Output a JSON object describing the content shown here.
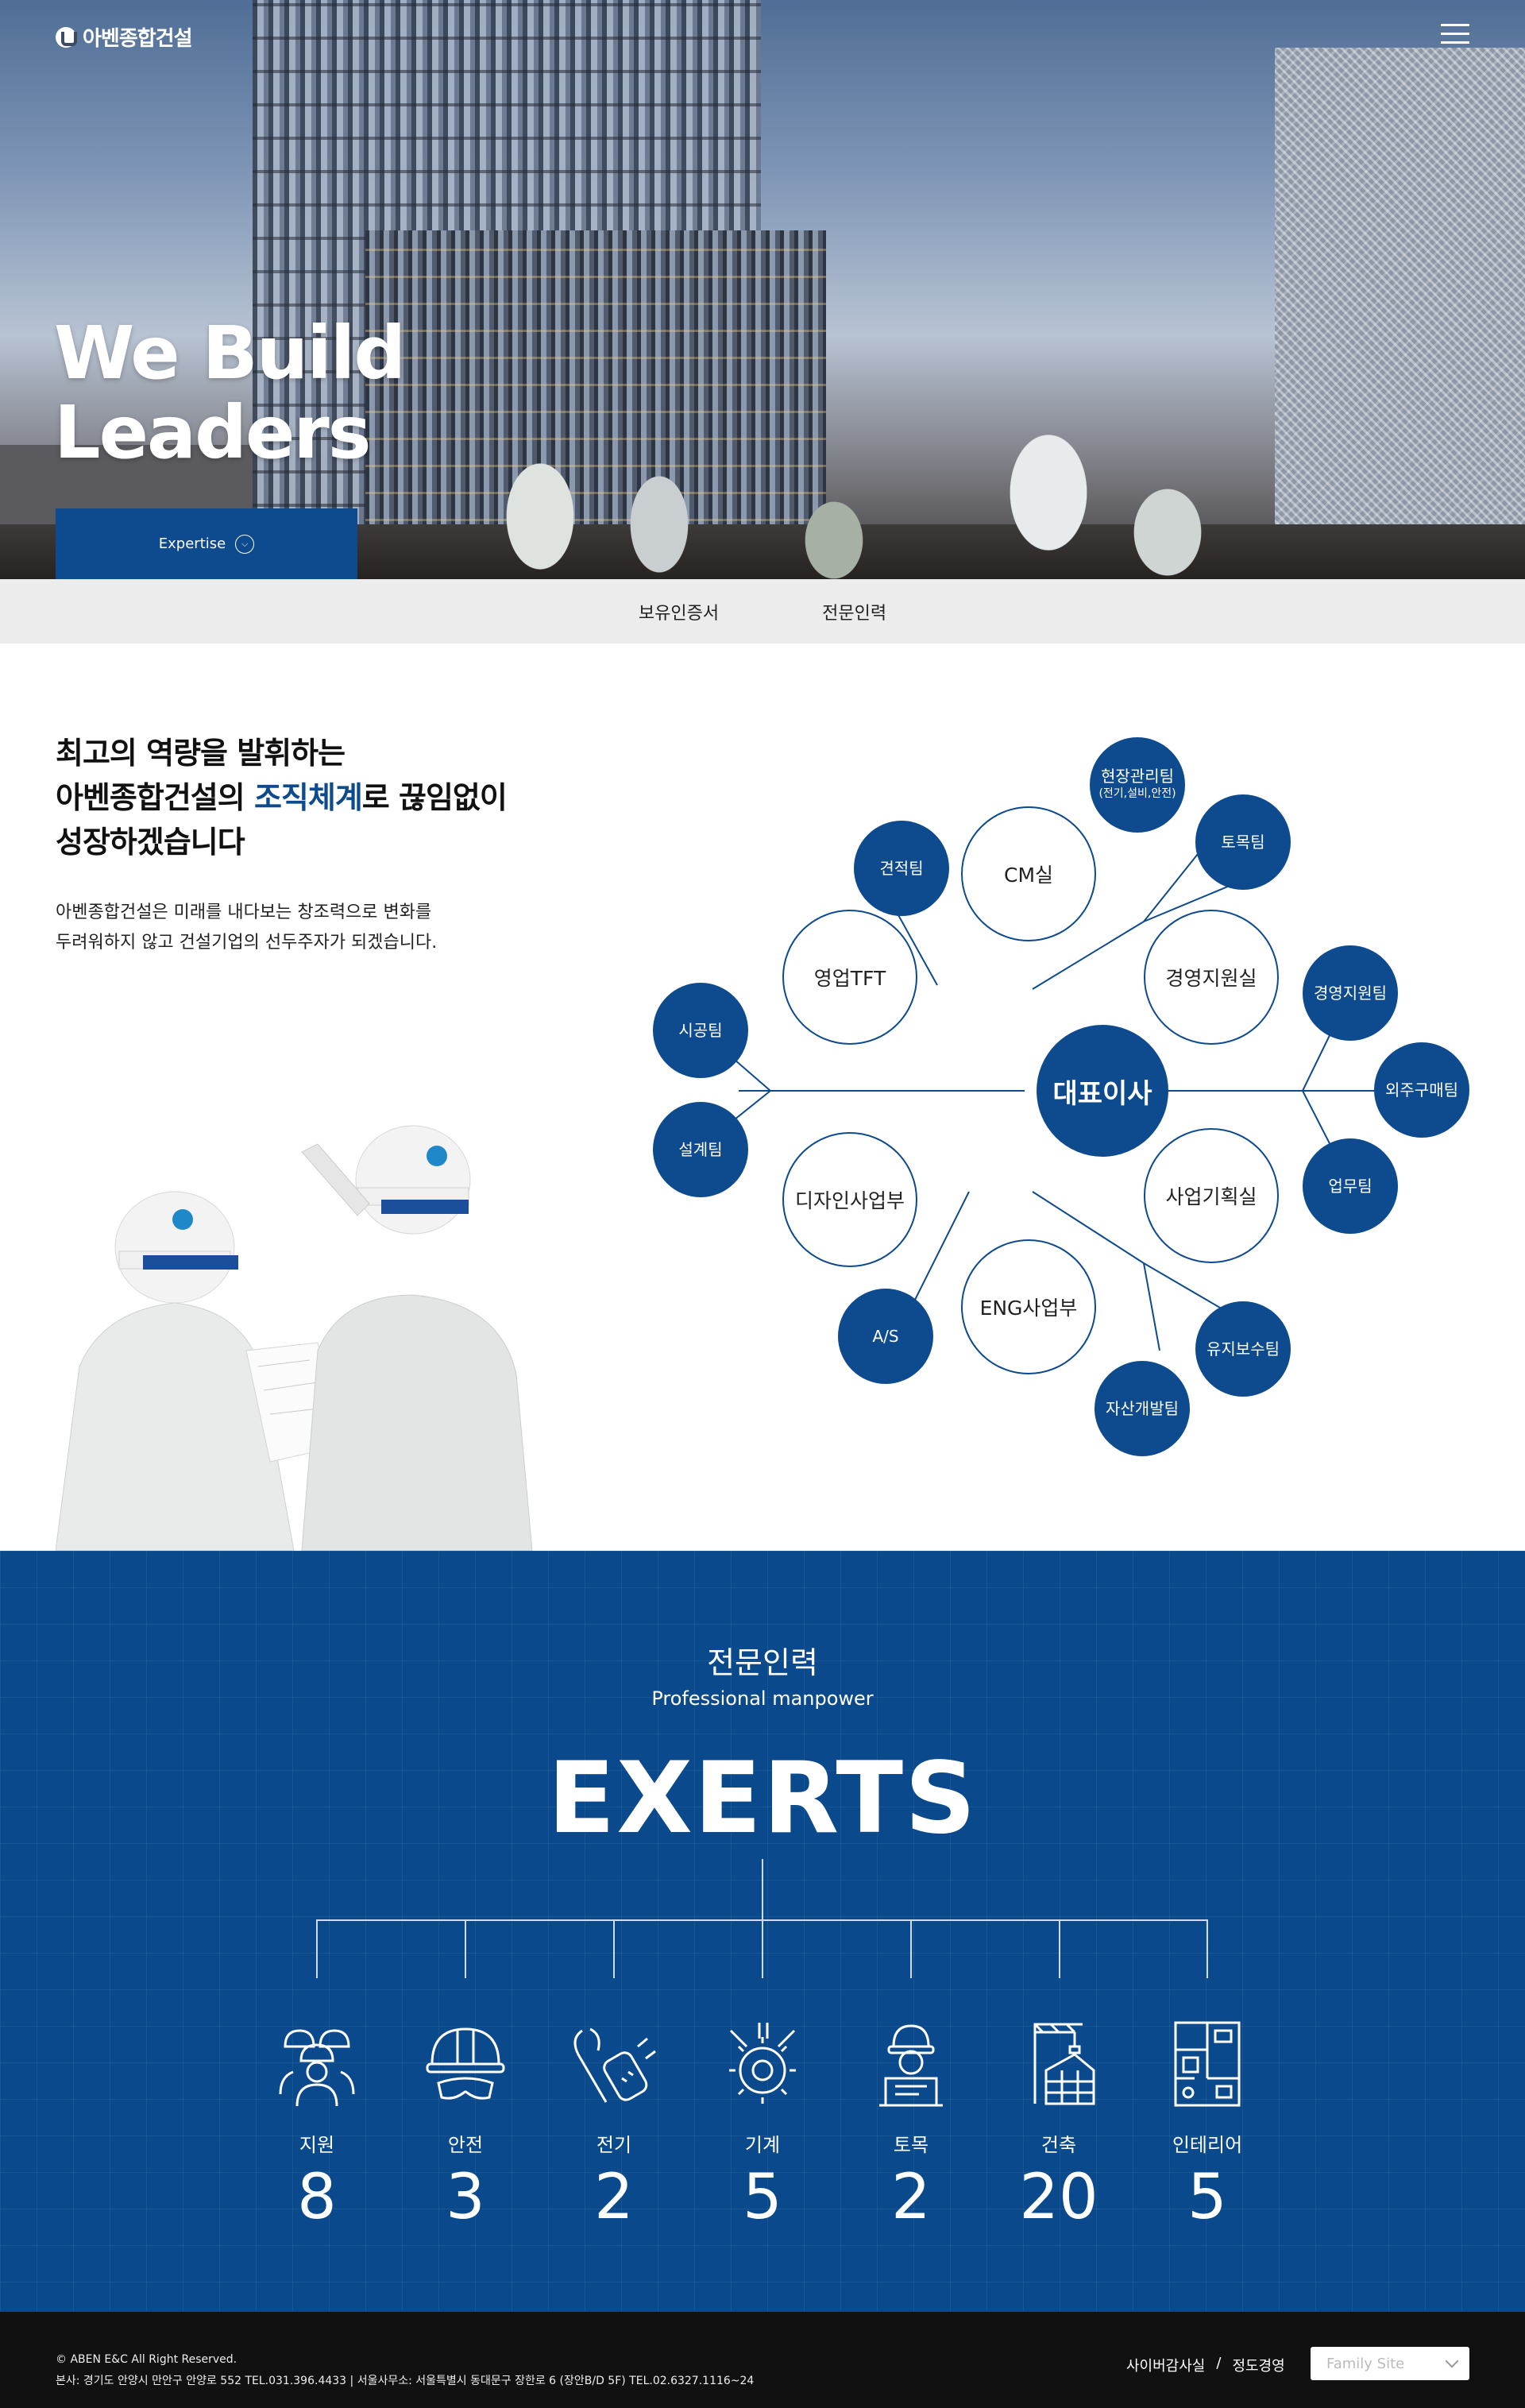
{
  "header": {
    "logo_text": "아벤종합건설",
    "menu_icon": "hamburger-menu-icon"
  },
  "hero": {
    "title_line1": "We Build",
    "title_line2": "Leaders",
    "button_label": "Expertise"
  },
  "tabs": [
    "보유인증서",
    "전문인력"
  ],
  "org": {
    "heading_line1": "최고의 역량을 발휘하는",
    "heading_line2_pre": "아벤종합건설의 ",
    "heading_line2_hl": "조직체계",
    "heading_line2_post": "로 끊임없이",
    "heading_line3": "성장하겠습니다",
    "desc_line1": "아벤종합건설은 미래를 내다보는 창조력으로 변화를",
    "desc_line2": "두려워하지 않고 건설기업의 선두주자가 되겠습니다.",
    "ceo": "대표이사",
    "departments": [
      "CM실",
      "경영지원실",
      "사업기획실",
      "ENG사업부",
      "디자인사업부",
      "영업TFT"
    ],
    "teams": {
      "t1": "현장관리팀",
      "t1_sub": "(전기,설비,안전)",
      "t2": "토목팀",
      "t3": "견적팀",
      "t4": "경영지원팀",
      "t5": "외주구매팀",
      "t6": "업무팀",
      "t7": "유지보수팀",
      "t8": "자산개발팀",
      "t9": "A/S",
      "t10": "시공팀",
      "t11": "설계팀"
    }
  },
  "experts": {
    "title": "전문인력",
    "subtitle": "Professional manpower",
    "big": "EXERTS",
    "items": [
      {
        "label": "지원",
        "count": "8",
        "icon": "team-workers-icon"
      },
      {
        "label": "안전",
        "count": "3",
        "icon": "safety-helmet-icon"
      },
      {
        "label": "전기",
        "count": "2",
        "icon": "electric-plug-icon"
      },
      {
        "label": "기계",
        "count": "5",
        "icon": "machine-gear-icon"
      },
      {
        "label": "토목",
        "count": "2",
        "icon": "civil-engineer-icon"
      },
      {
        "label": "건축",
        "count": "20",
        "icon": "building-crane-icon"
      },
      {
        "label": "인테리어",
        "count": "5",
        "icon": "floor-plan-icon"
      }
    ]
  },
  "footer": {
    "copyright": "© ABEN E&C All Right Reserved.",
    "address": "본사: 경기도 안양시 만안구 안양로 552  TEL.031.396.4433  |  서울사무소: 서울특별시 동대문구 장한로 6 (장안B/D 5F) TEL.02.6327.1116~24",
    "link1": "사이버감사실",
    "separator": "/",
    "link2": "정도경영",
    "family_placeholder": "Family Site"
  },
  "colors": {
    "brand": "#0d4a8e",
    "section_bg": "#0a4a8c",
    "footer_bg": "#111111"
  }
}
